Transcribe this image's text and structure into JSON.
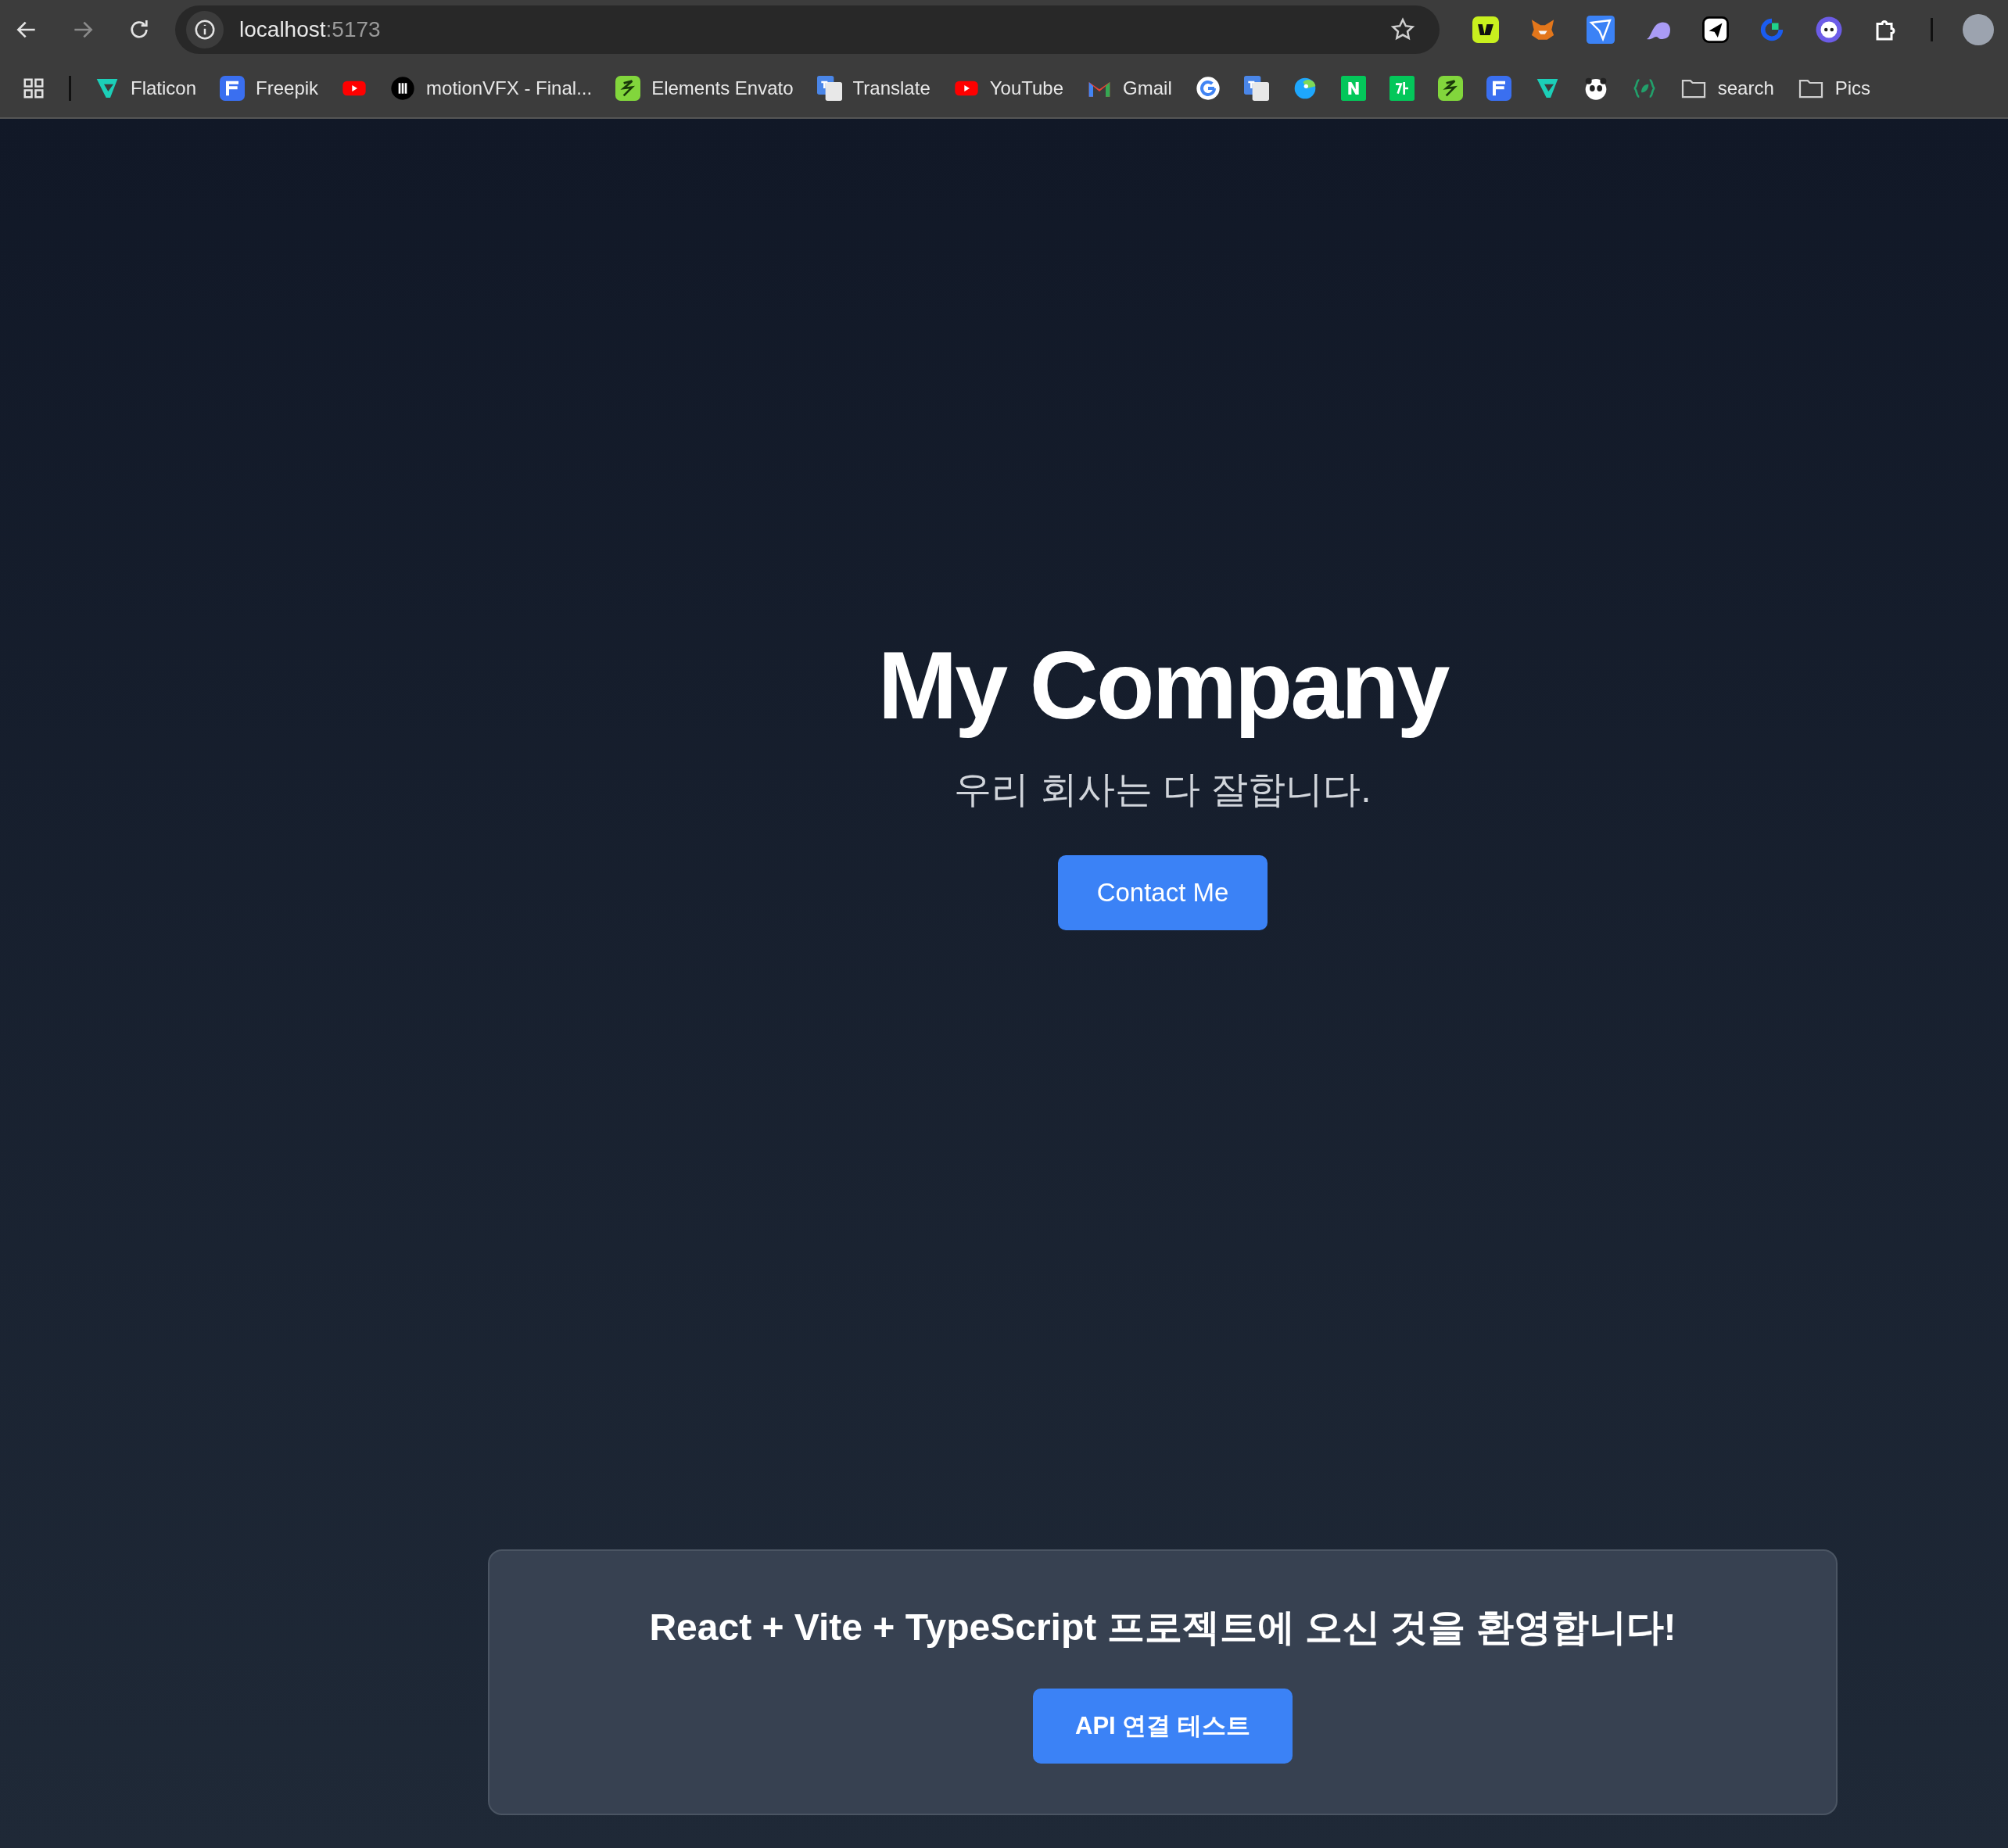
{
  "address_bar": {
    "host": "localhost",
    "port": ":5173"
  },
  "bookmarks": [
    {
      "kind": "site",
      "label": "Flaticon"
    },
    {
      "kind": "site",
      "label": "Freepik"
    },
    {
      "kind": "site"
    },
    {
      "kind": "site",
      "label": "motionVFX - Final..."
    },
    {
      "kind": "site",
      "label": "Elements Envato"
    },
    {
      "kind": "site",
      "label": "Translate"
    },
    {
      "kind": "site",
      "label": "YouTube"
    },
    {
      "kind": "site",
      "label": "Gmail"
    },
    {
      "kind": "site"
    },
    {
      "kind": "site"
    },
    {
      "kind": "site"
    },
    {
      "kind": "site"
    },
    {
      "kind": "site"
    },
    {
      "kind": "site"
    },
    {
      "kind": "site"
    },
    {
      "kind": "site"
    },
    {
      "kind": "site"
    },
    {
      "kind": "site"
    },
    {
      "kind": "folder",
      "label": "search"
    },
    {
      "kind": "folder",
      "label": "Pics"
    }
  ],
  "hero": {
    "title": "My Company",
    "subtitle": "우리 회사는 다 잘합니다.",
    "button": "Contact Me"
  },
  "card": {
    "heading": "React + Vite + TypeScript 프로젝트에 오신 것을 환영합니다!",
    "button": "API 연결 테스트"
  }
}
